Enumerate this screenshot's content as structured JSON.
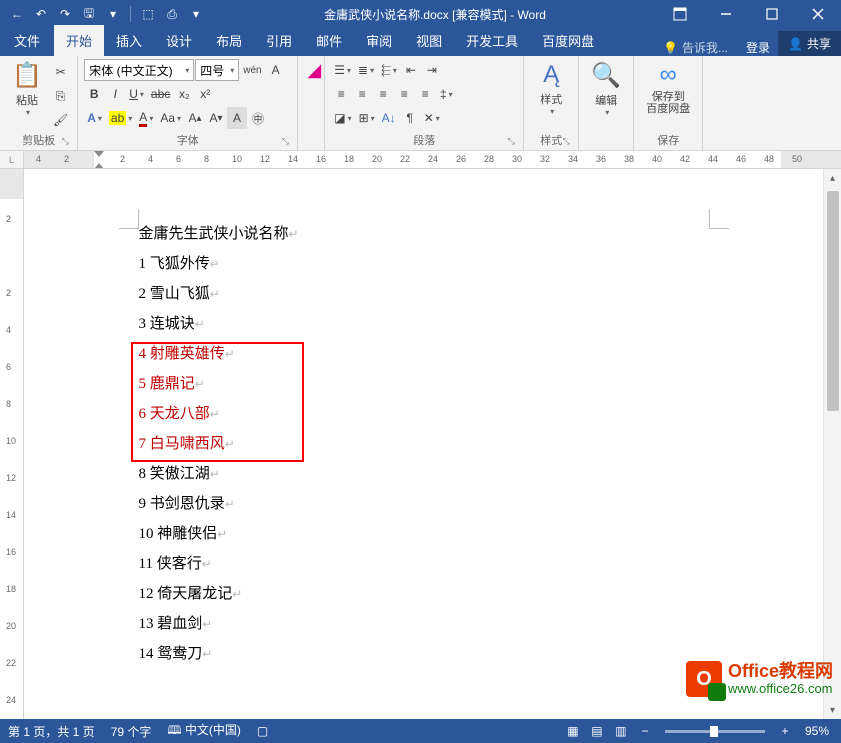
{
  "titlebar": {
    "doc_title": "金庸武侠小说名称.docx [兼容模式] - Word"
  },
  "tabs": {
    "file": "文件",
    "items": [
      "开始",
      "插入",
      "设计",
      "布局",
      "引用",
      "邮件",
      "审阅",
      "视图",
      "开发工具",
      "百度网盘"
    ],
    "active_index": 0,
    "tell_me": "告诉我...",
    "signin": "登录",
    "share": "共享"
  },
  "ribbon": {
    "clipboard": {
      "label": "剪贴板",
      "paste": "粘贴"
    },
    "font": {
      "label": "字体",
      "font_name": "宋体 (中文正文)",
      "font_size": "四号"
    },
    "paragraph": {
      "label": "段落"
    },
    "styles": {
      "label": "样式",
      "btn": "样式"
    },
    "editing": {
      "label": "",
      "btn": "编辑"
    },
    "save": {
      "label": "保存",
      "btn": "保存到\n百度网盘"
    }
  },
  "document": {
    "title": "金庸先生武侠小说名称",
    "lines": [
      {
        "n": "1",
        "t": "飞狐外传",
        "red": false
      },
      {
        "n": "2",
        "t": "雪山飞狐",
        "red": false
      },
      {
        "n": "3",
        "t": "连城诀",
        "red": false
      },
      {
        "n": "4",
        "t": "射雕英雄传",
        "red": true
      },
      {
        "n": "5",
        "t": "鹿鼎记",
        "red": true
      },
      {
        "n": "6",
        "t": "天龙八部",
        "red": true
      },
      {
        "n": "7",
        "t": "白马啸西风",
        "red": true
      },
      {
        "n": "8",
        "t": "笑傲江湖",
        "red": false
      },
      {
        "n": "9",
        "t": "书剑恩仇录",
        "red": false
      },
      {
        "n": "10",
        "t": "神雕侠侣",
        "red": false
      },
      {
        "n": "11",
        "t": "侠客行",
        "red": false
      },
      {
        "n": "12",
        "t": "倚天屠龙记",
        "red": false
      },
      {
        "n": "13",
        "t": "碧血剑",
        "red": false
      },
      {
        "n": "14",
        "t": "鸳鸯刀",
        "red": false
      }
    ]
  },
  "ruler_h": [
    "4",
    "2",
    "",
    "2",
    "4",
    "6",
    "8",
    "10",
    "12",
    "14",
    "16",
    "18",
    "20",
    "22",
    "24",
    "26",
    "28",
    "30",
    "32",
    "34",
    "36",
    "38",
    "40",
    "42",
    "44",
    "46",
    "48",
    "50"
  ],
  "ruler_v": [
    "",
    "2",
    "",
    "2",
    "4",
    "6",
    "8",
    "10",
    "12",
    "14",
    "16",
    "18",
    "20",
    "22",
    "24"
  ],
  "status": {
    "page": "第 1 页，共 1 页",
    "words": "79 个字",
    "lang": "中文(中国)",
    "zoom": "95%"
  },
  "watermark": {
    "top": "Office教程网",
    "bot": "www.office26.com"
  }
}
